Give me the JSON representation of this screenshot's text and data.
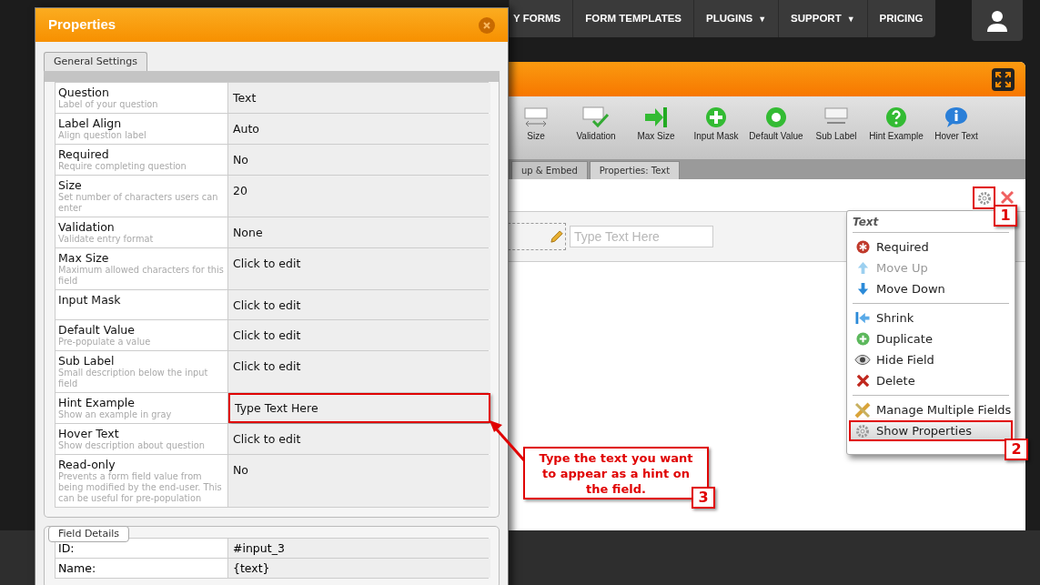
{
  "nav": {
    "items": [
      {
        "label": "Y FORMS"
      },
      {
        "label": "FORM TEMPLATES"
      },
      {
        "label": "PLUGINS",
        "caret": "▼"
      },
      {
        "label": "SUPPORT",
        "caret": "▼"
      },
      {
        "label": "PRICING"
      }
    ]
  },
  "builder": {
    "toolbar": [
      {
        "label": "Size",
        "kind": "size"
      },
      {
        "label": "Validation",
        "kind": "validation"
      },
      {
        "label": "Max Size",
        "kind": "maxsize"
      },
      {
        "label": "Input Mask",
        "kind": "plus"
      },
      {
        "label": "Default Value",
        "kind": "dot"
      },
      {
        "label": "Sub Label",
        "kind": "sublabel"
      },
      {
        "label": "Hint Example",
        "kind": "question"
      },
      {
        "label": "Hover Text",
        "kind": "info"
      }
    ],
    "tabs": [
      {
        "label": "up & Embed",
        "selected": false
      },
      {
        "label": "Properties: Text",
        "selected": true
      }
    ],
    "field": {
      "placeholder": "Type Text Here"
    }
  },
  "context_menu": {
    "title": "Text",
    "groups": [
      [
        {
          "label": "Required",
          "kind": "required",
          "disabled": false,
          "highlighted": false
        },
        {
          "label": "Move Up",
          "kind": "up",
          "disabled": true,
          "highlighted": false
        },
        {
          "label": "Move Down",
          "kind": "down",
          "disabled": false,
          "highlighted": false
        }
      ],
      [
        {
          "label": "Shrink",
          "kind": "shrink",
          "disabled": false,
          "highlighted": false
        },
        {
          "label": "Duplicate",
          "kind": "duplicate",
          "disabled": false,
          "highlighted": false
        },
        {
          "label": "Hide Field",
          "kind": "eye",
          "disabled": false,
          "highlighted": false
        },
        {
          "label": "Delete",
          "kind": "delete",
          "disabled": false,
          "highlighted": false
        }
      ],
      [
        {
          "label": "Manage Multiple Fields",
          "kind": "manage",
          "disabled": false,
          "highlighted": false
        },
        {
          "label": "Show Properties",
          "kind": "gear",
          "disabled": false,
          "highlighted": true
        }
      ]
    ]
  },
  "properties": {
    "title": "Properties",
    "tabs": [
      {
        "label": "General Settings",
        "selected": true
      }
    ],
    "rows": [
      {
        "label": "Question",
        "description": "Label of your question",
        "value": "Text",
        "framed": false
      },
      {
        "label": "Label Align",
        "description": "Align question label",
        "value": "Auto",
        "framed": false
      },
      {
        "label": "Required",
        "description": "Require completing question",
        "value": "No",
        "framed": false
      },
      {
        "label": "Size",
        "description": "Set number of characters users can enter",
        "value": "20",
        "framed": false
      },
      {
        "label": "Validation",
        "description": "Validate entry format",
        "value": "None",
        "framed": false
      },
      {
        "label": "Max Size",
        "description": "Maximum allowed characters for this field",
        "value": "Click to edit",
        "framed": false
      },
      {
        "label": "Input Mask",
        "value": "Click to edit",
        "framed": false
      },
      {
        "label": "Default Value",
        "description": "Pre-populate a value",
        "value": "Click to edit",
        "framed": false
      },
      {
        "label": "Sub Label",
        "description": "Small description below the input field",
        "value": "Click to edit",
        "framed": false
      },
      {
        "label": "Hint Example",
        "description": "Show an example in gray",
        "value": "Type Text Here",
        "framed": true
      },
      {
        "label": "Hover Text",
        "description": "Show description about question",
        "value": "Click to edit",
        "framed": false
      },
      {
        "label": "Read-only",
        "description": "Prevents a form field value from being modified by the end-user. This can be useful for pre-population",
        "value": "No",
        "framed": false
      }
    ],
    "details_legend": "Field Details",
    "details": [
      {
        "label": "ID:",
        "value": "#input_3"
      },
      {
        "label": "Name:",
        "value": "{text}"
      }
    ]
  },
  "annotations": [
    {
      "number": "1"
    },
    {
      "number": "2"
    },
    {
      "number": "3",
      "text": "Type the text you want to appear as a hint on the field."
    }
  ]
}
